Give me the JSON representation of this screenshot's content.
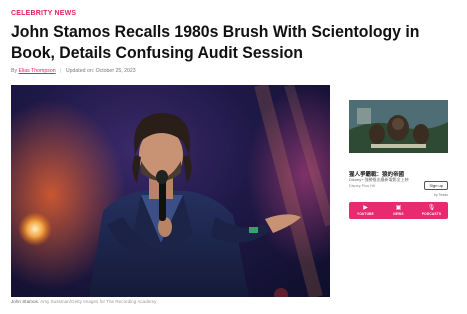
{
  "article": {
    "category": "CELEBRITY NEWS",
    "headline": "John Stamos Recalls 1980s Brush With Scientology in Book, Details Confusing Audit Session",
    "byline_prefix": "By",
    "author": "Elias Thompson",
    "updated": "Updated on: October 25, 2023"
  },
  "photo": {
    "caption": "John Stamos",
    "credit": "Amy Sussman/Getty Images for The Recording Academy"
  },
  "ad": {
    "title": "猩人爭霸戰：猿的帝國",
    "description": "Disney+ 強勢推出最新電影全上映",
    "brand": "Disney Plus HK",
    "cta": "Sign up",
    "by_label": "by Teads"
  },
  "app_bar": {
    "items": [
      {
        "label": "YOUTUBE",
        "icon": "youtube-icon",
        "glyph": "▶"
      },
      {
        "label": "NEWS",
        "icon": "news-icon",
        "glyph": "▣"
      },
      {
        "label": "PODCASTS",
        "icon": "podcast-icon",
        "glyph": "🎙"
      }
    ]
  },
  "colors": {
    "accent": "#e0245e",
    "app_bar": "#ea2a6e"
  }
}
